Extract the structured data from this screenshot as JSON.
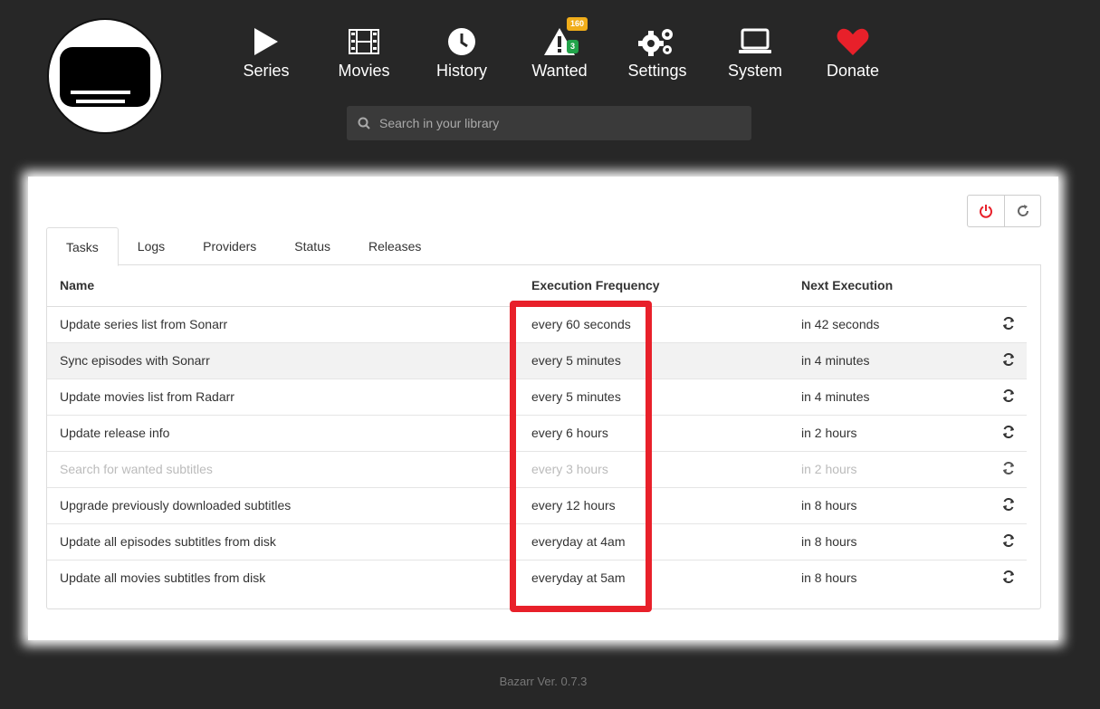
{
  "nav": [
    {
      "label": "Series",
      "icon": "play-icon"
    },
    {
      "label": "Movies",
      "icon": "film-icon"
    },
    {
      "label": "History",
      "icon": "clock-icon"
    },
    {
      "label": "Wanted",
      "icon": "warning-icon"
    },
    {
      "label": "Settings",
      "icon": "gears-icon"
    },
    {
      "label": "System",
      "icon": "laptop-icon"
    },
    {
      "label": "Donate",
      "icon": "heart-icon"
    }
  ],
  "badges": {
    "wanted_series": "160",
    "wanted_movies": "3"
  },
  "search": {
    "placeholder": "Search in your library"
  },
  "tabs": [
    "Tasks",
    "Logs",
    "Providers",
    "Status",
    "Releases"
  ],
  "table": {
    "headers": {
      "name": "Name",
      "frequency": "Execution Frequency",
      "next": "Next Execution"
    },
    "rows": [
      {
        "name": "Update series list from Sonarr",
        "frequency": "every 60 seconds",
        "next": "in 42 seconds"
      },
      {
        "name": "Sync episodes with Sonarr",
        "frequency": "every 5 minutes",
        "next": "in 4 minutes"
      },
      {
        "name": "Update movies list from Radarr",
        "frequency": "every 5 minutes",
        "next": "in 4 minutes"
      },
      {
        "name": "Update release info",
        "frequency": "every 6 hours",
        "next": "in 2 hours"
      },
      {
        "name": "Search for wanted subtitles",
        "frequency": "every 3 hours",
        "next": "in 2 hours"
      },
      {
        "name": "Upgrade previously downloaded subtitles",
        "frequency": "every 12 hours",
        "next": "in 8 hours"
      },
      {
        "name": "Update all episodes subtitles from disk",
        "frequency": "everyday at 4am",
        "next": "in 8 hours"
      },
      {
        "name": "Update all movies subtitles from disk",
        "frequency": "everyday at 5am",
        "next": "in 8 hours"
      }
    ]
  },
  "footer": "Bazarr Ver. 0.7.3",
  "colors": {
    "background": "#272727",
    "accent_red": "#e8202a",
    "heart": "#e8202a",
    "badge_yellow": "#f0ad1a",
    "badge_green": "#22a34a"
  }
}
